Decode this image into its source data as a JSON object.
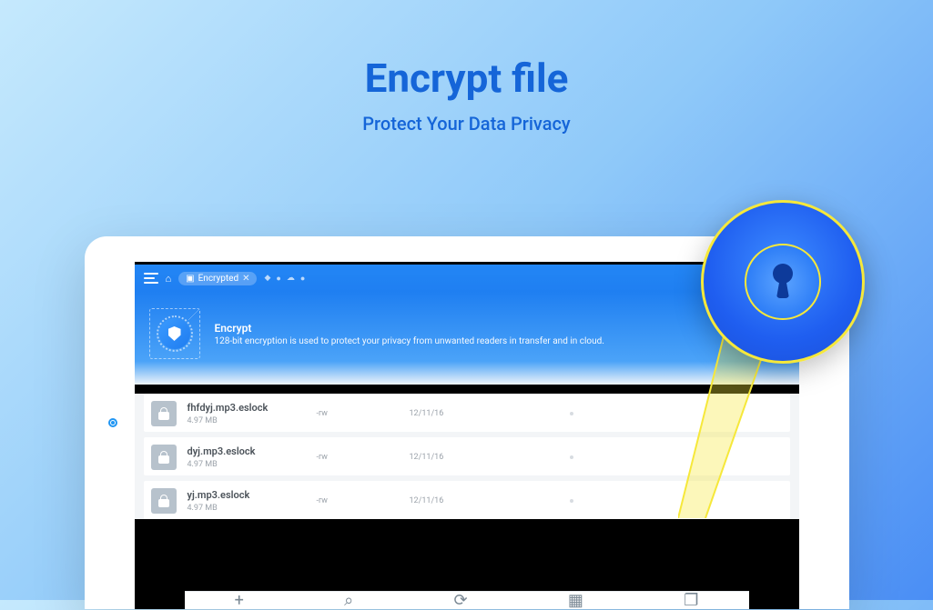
{
  "hero": {
    "title": "Encrypt file",
    "subtitle": "Protect Your Data Privacy"
  },
  "toolbar": {
    "chip_label": "Encrypted"
  },
  "banner": {
    "title": "Encrypt",
    "desc": "128-bit encryption is used to protect your privacy from unwanted readers in transfer and in cloud."
  },
  "files": [
    {
      "name": "fhfdyj.mp3.eslock",
      "size": "4.97 MB",
      "perm": "-rw",
      "date": "12/11/16"
    },
    {
      "name": "dyj.mp3.eslock",
      "size": "4.97 MB",
      "perm": "-rw",
      "date": "12/11/16"
    },
    {
      "name": "yj.mp3.eslock",
      "size": "4.97 MB",
      "perm": "-rw",
      "date": "12/11/16"
    }
  ]
}
